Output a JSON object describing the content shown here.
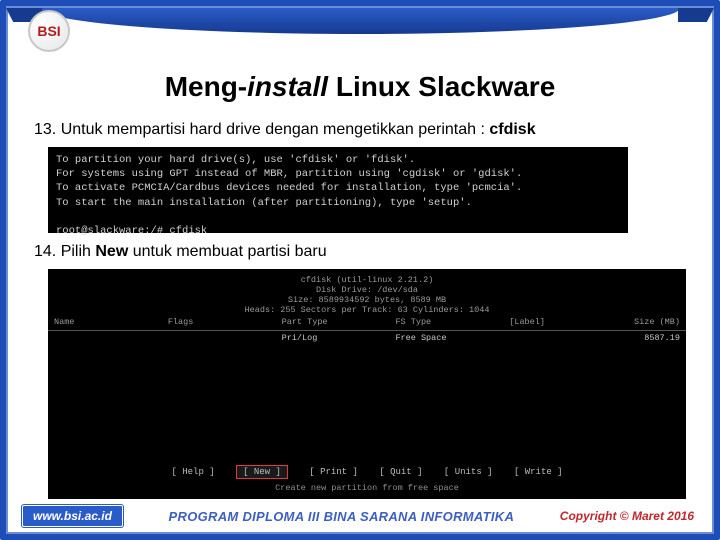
{
  "logo": "BSI",
  "title_a": "Meng-",
  "title_b": "install",
  "title_c": " Linux Slackware",
  "step13": "13. Untuk mempartisi hard drive dengan mengetikkan perintah : ",
  "step13_cmd": "cfdisk",
  "term1": "To partition your hard drive(s), use 'cfdisk' or 'fdisk'.\nFor systems using GPT instead of MBR, partition using 'cgdisk' or 'gdisk'.\nTo activate PCMCIA/Cardbus devices needed for installation, type 'pcmcia'.\nTo start the main installation (after partitioning), type 'setup'.\n\nroot@slackware:/# cfdisk",
  "step14_a": "14. Pilih ",
  "step14_b": "New",
  "step14_c": " untuk membuat partisi baru",
  "t2": {
    "head1": "cfdisk (util-linux 2.21.2)",
    "head2": "Disk Drive: /dev/sda",
    "head3": "Size: 8589934592 bytes, 8589 MB",
    "head4": "Heads: 255   Sectors per Track: 63   Cylinders: 1044",
    "cols": [
      "Name",
      "Flags",
      "Part Type",
      "FS Type",
      "[Label]",
      "Size (MB)"
    ],
    "row": [
      "",
      "",
      "Pri/Log",
      "Free Space",
      "",
      "8587.19"
    ],
    "menu": [
      "[  Help  ]",
      "[  New   ]",
      "[  Print  ]",
      "[  Quit  ]",
      "[  Units  ]",
      "[  Write  ]"
    ],
    "hint": "Create new partition from free space"
  },
  "footer": {
    "url": "www.bsi.ac.id",
    "program": "PROGRAM DIPLOMA III BINA SARANA INFORMATIKA",
    "copy": "Copyright © Maret 2016"
  }
}
